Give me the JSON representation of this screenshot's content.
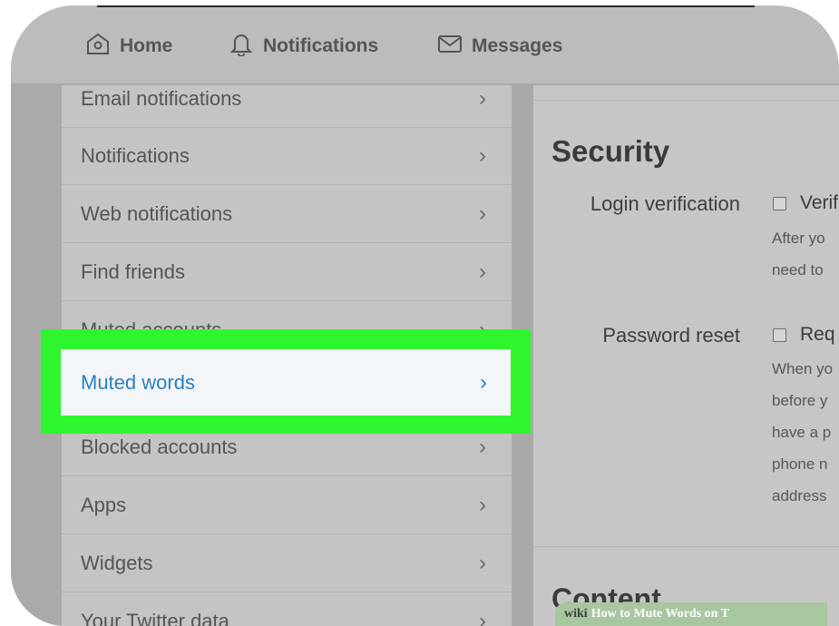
{
  "topnav": {
    "items": [
      {
        "label": "Home",
        "icon": "home-icon"
      },
      {
        "label": "Notifications",
        "icon": "bell-icon"
      },
      {
        "label": "Messages",
        "icon": "envelope-icon"
      }
    ]
  },
  "sidebar": {
    "items": [
      {
        "label": "Email notifications"
      },
      {
        "label": "Notifications"
      },
      {
        "label": "Web notifications"
      },
      {
        "label": "Find friends"
      },
      {
        "label": "Muted accounts"
      },
      {
        "label": "Muted words",
        "selected": true
      },
      {
        "label": "Blocked accounts"
      },
      {
        "label": "Apps"
      },
      {
        "label": "Widgets"
      },
      {
        "label": "Your Twitter data"
      }
    ],
    "chevron": "›"
  },
  "content": {
    "security_title": "Security",
    "login_verification": {
      "label": "Login verification",
      "option": "Verif",
      "help": [
        "After yo",
        "need to"
      ]
    },
    "password_reset": {
      "label": "Password reset",
      "option": "Req",
      "help": [
        "When yo",
        "before y",
        "have a p",
        "phone n",
        "address"
      ]
    },
    "content_title": "Content"
  },
  "watermark": {
    "wiki": "wiki",
    "text": "How to Mute Words on T"
  },
  "colors": {
    "highlight": "#2ef52e",
    "selected_text": "#2a7fc0"
  }
}
